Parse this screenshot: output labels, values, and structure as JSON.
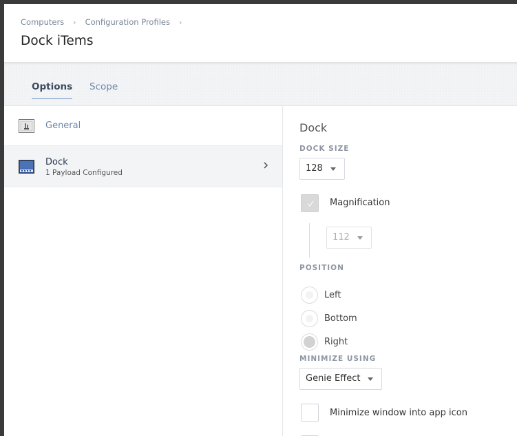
{
  "breadcrumb": {
    "items": [
      "Computers",
      "Configuration Profiles"
    ],
    "separator": "›"
  },
  "page": {
    "title": "Dock iTems"
  },
  "tabs": [
    {
      "label": "Options",
      "active": true
    },
    {
      "label": "Scope",
      "active": false
    }
  ],
  "sidebar": {
    "items": [
      {
        "label": "General",
        "icon": "general-settings-icon"
      },
      {
        "label": "Dock",
        "sublabel": "1 Payload Configured",
        "icon": "dock-icon",
        "selected": true
      }
    ]
  },
  "dock": {
    "title": "Dock",
    "dock_size": {
      "label": "DOCK SIZE",
      "value": "128"
    },
    "magnification": {
      "label": "Magnification",
      "checked": true,
      "value": "112"
    },
    "position": {
      "label": "POSITION",
      "options": [
        "Left",
        "Bottom",
        "Right"
      ],
      "selected": "Right"
    },
    "minimize": {
      "label": "MINIMIZE USING",
      "value": "Genie Effect"
    },
    "minimize_into_icon": {
      "label": "Minimize window into app icon",
      "checked": false
    }
  },
  "colors": {
    "accent": "#6b86ad",
    "tab_underline": "#a9bfe0",
    "selected_row": "#f3f4f6"
  }
}
